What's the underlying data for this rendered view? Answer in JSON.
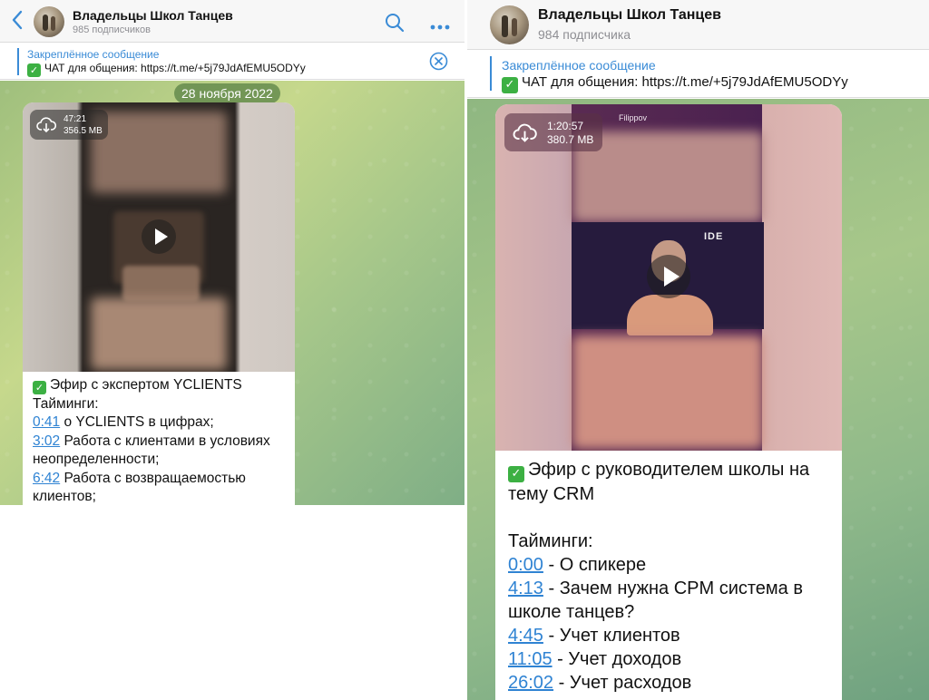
{
  "left": {
    "channel_title": "Владельцы Школ Танцев",
    "subscribers": "985 подписчиков",
    "pinned_title": "Закреплённое сообщение",
    "pinned_text": "ЧАТ для общения:  https://t.me/+5j79JdAfEMU5ODYy",
    "date": "28 ноября 2022",
    "video_duration": "47:21",
    "video_size": "356.5 MB",
    "post": {
      "title": "Эфир с экспертом YCLIENTS",
      "timings_label": "Тайминги:",
      "items": [
        {
          "time": "0:41",
          "text": " о YCLIENTS в цифрах;"
        },
        {
          "time": "3:02",
          "text": " Работа с клиентами в условиях неопределенности;"
        },
        {
          "time": "6:42",
          "text": " Работа с возвращаемостью клиентов;"
        }
      ]
    }
  },
  "right": {
    "channel_title": "Владельцы Школ Танцев",
    "subscribers": "984 подписчика",
    "pinned_title": "Закреплённое сообщение",
    "pinned_text": "ЧАТ для общения:  https://t.me/+5j79JdAfEMU5ODYy",
    "video_duration": "1:20:57",
    "video_size": "380.7 MB",
    "video_overlay_text": "Filippov",
    "post": {
      "title": "Эфир с руководителем школы на тему CRM",
      "timings_label": "Тайминги:",
      "items": [
        {
          "time": "0:00",
          "text": " - О спикере"
        },
        {
          "time": "4:13",
          "text": " - Зачем нужна CPM система в школе танцев?"
        },
        {
          "time": "4:45",
          "text": " - Учет клиентов"
        },
        {
          "time": "11:05",
          "text": " - Учет доходов"
        },
        {
          "time": "26:02",
          "text": " - Учет расходов"
        }
      ]
    }
  },
  "icons": {
    "back": "chevron-left-icon",
    "search": "search-icon",
    "more": "more-horizontal-icon",
    "close": "close-circle-icon",
    "download": "cloud-download-icon",
    "play": "play-icon",
    "check": "check-mark-icon"
  },
  "colors": {
    "accent": "#3a8bd6",
    "link": "#2f83d3",
    "check_green": "#3cb043"
  }
}
